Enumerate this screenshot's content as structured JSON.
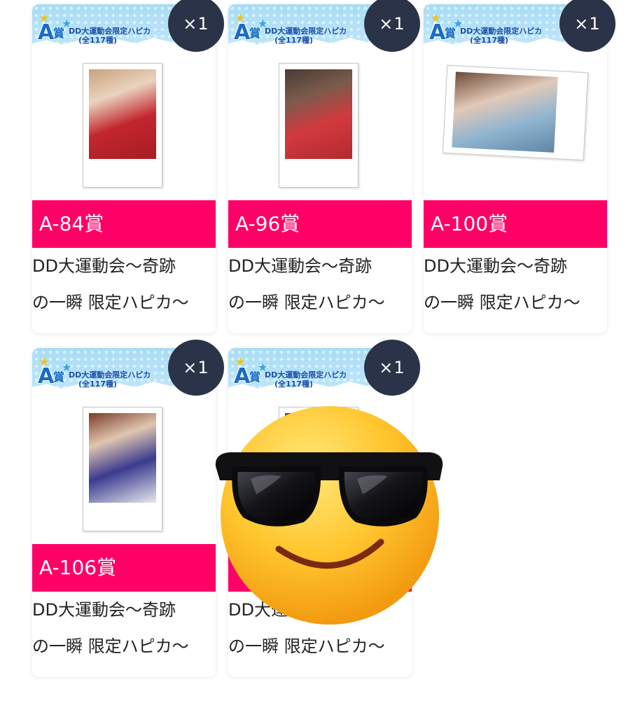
{
  "colors": {
    "prize_bar": "#ff0066",
    "qty_badge": "#2b3348",
    "banner_blue": "#a8dcf6"
  },
  "banner": {
    "letter": "A",
    "sho": "賞",
    "title": "DD大運動会限定ハピカ",
    "count": "(全117種)"
  },
  "cards": [
    {
      "qty": "×1",
      "prize": "A-84賞",
      "desc_line1": "DD大運動会〜奇跡",
      "desc_line2": "の一瞬 限定ハピカ〜"
    },
    {
      "qty": "×1",
      "prize": "A-96賞",
      "desc_line1": "DD大運動会〜奇跡",
      "desc_line2": "の一瞬 限定ハピカ〜"
    },
    {
      "qty": "×1",
      "prize": "A-100賞",
      "desc_line1": "DD大運動会〜奇跡",
      "desc_line2": "の一瞬 限定ハピカ〜"
    },
    {
      "qty": "×1",
      "prize": "A-106賞",
      "desc_line1": "DD大運動会〜奇跡",
      "desc_line2": "の一瞬 限定ハピカ〜"
    },
    {
      "qty": "×1",
      "prize": "",
      "desc_line1": "DD大運動会〜奇跡",
      "desc_line2": "の一瞬 限定ハピカ〜"
    }
  ],
  "overlay": {
    "icon": "smiling-face-with-sunglasses-icon"
  }
}
